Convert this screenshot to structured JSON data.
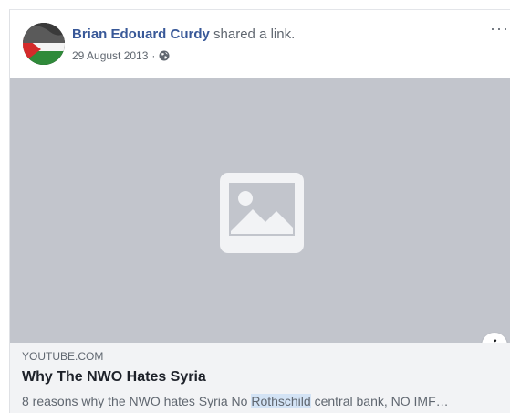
{
  "post": {
    "author": "Brian Edouard Curdy",
    "action": "shared a link.",
    "date": "29 August 2013",
    "separator": "·",
    "privacy_icon": "globe-icon",
    "more_label": "···"
  },
  "link_preview": {
    "domain": "YOUTUBE.COM",
    "title": "Why The NWO Hates Syria",
    "description_before": "8 reasons why the NWO hates Syria No ",
    "description_highlight": "Rothschild",
    "description_after": " central bank, NO IMF…",
    "info_label": "i",
    "image_placeholder_icon": "image-placeholder-icon"
  },
  "colors": {
    "author_link": "#385898",
    "media_bg": "#c2c5cc",
    "link_box_bg": "#f2f3f5",
    "highlight": "#d3e3f5"
  }
}
